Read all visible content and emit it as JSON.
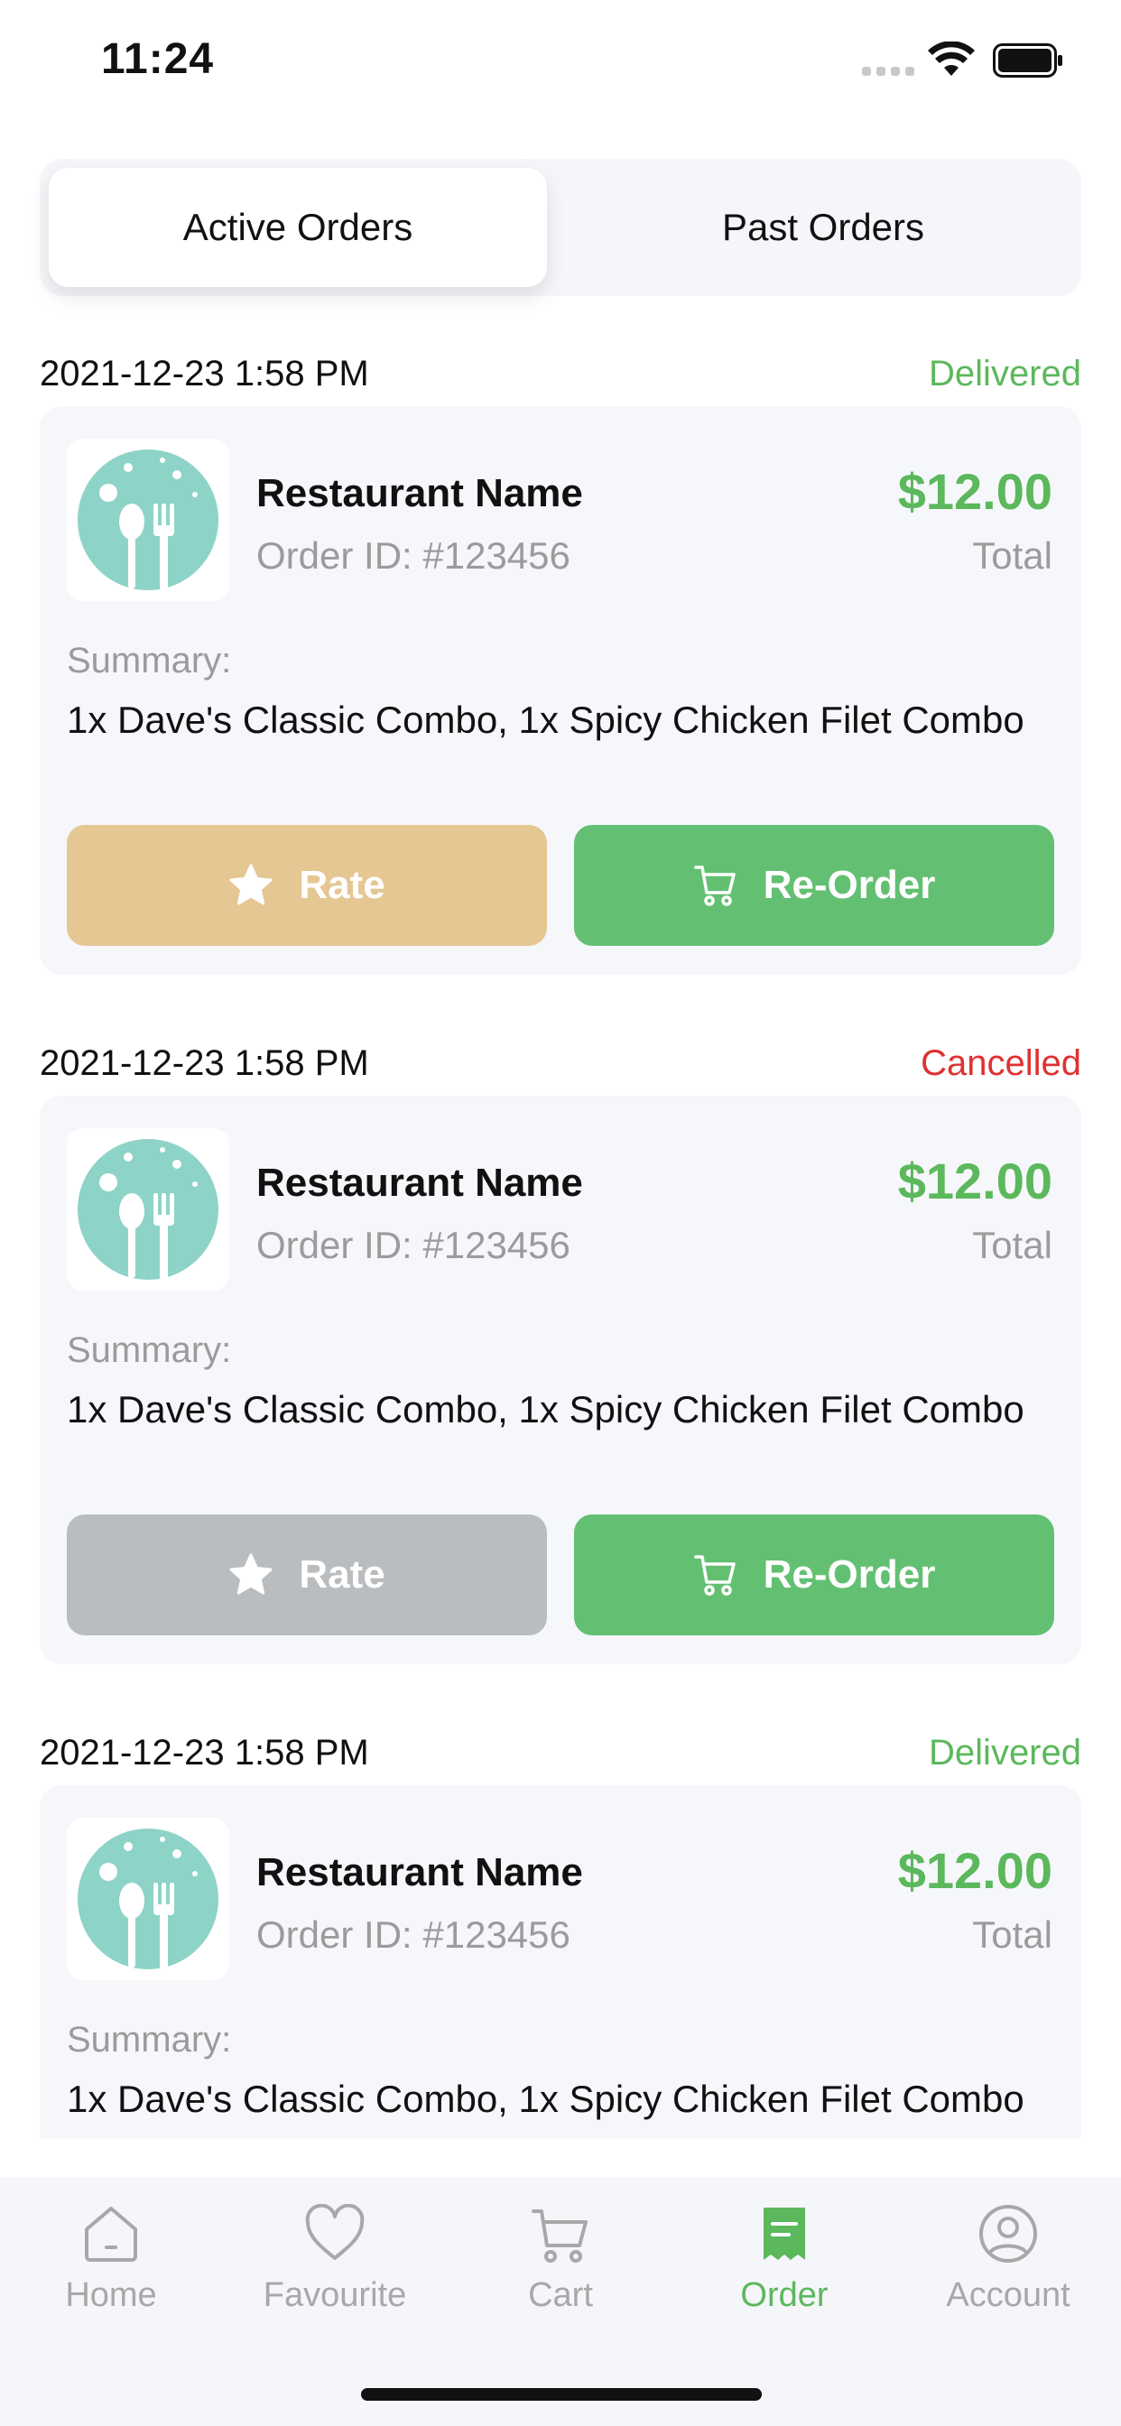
{
  "status_bar": {
    "time": "11:24"
  },
  "tabs": {
    "active": "Active Orders",
    "past": "Past Orders"
  },
  "orders": [
    {
      "date": "2021-12-23 1:58 PM",
      "status": "Delivered",
      "status_color": "#5cb85c",
      "restaurant": "Restaurant Name",
      "order_id": "Order ID: #123456",
      "price": "$12.00",
      "total_label": "Total",
      "summary_label": "Summary:",
      "summary": "1x Dave's Classic Combo, 1x Spicy Chicken Filet Combo",
      "rate_label": "Rate",
      "rate_color": "#e4c793",
      "reorder_label": "Re-Order"
    },
    {
      "date": "2021-12-23 1:58 PM",
      "status": "Cancelled",
      "status_color": "#e03131",
      "restaurant": "Restaurant Name",
      "order_id": "Order ID: #123456",
      "price": "$12.00",
      "total_label": "Total",
      "summary_label": "Summary:",
      "summary": "1x Dave's Classic Combo, 1x Spicy Chicken Filet Combo",
      "rate_label": "Rate",
      "rate_color": "#babdc0",
      "reorder_label": "Re-Order"
    },
    {
      "date": "2021-12-23 1:58 PM",
      "status": "Delivered",
      "status_color": "#5cb85c",
      "restaurant": "Restaurant Name",
      "order_id": "Order ID: #123456",
      "price": "$12.00",
      "total_label": "Total",
      "summary_label": "Summary:",
      "summary": "1x Dave's Classic Combo, 1x Spicy Chicken Filet Combo",
      "rate_label": "Rate",
      "rate_color": "#e4c793",
      "reorder_label": "Re-Order"
    }
  ],
  "nav": {
    "items": [
      {
        "label": "Home",
        "icon": "home-icon"
      },
      {
        "label": "Favourite",
        "icon": "heart-icon"
      },
      {
        "label": "Cart",
        "icon": "cart-icon"
      },
      {
        "label": "Order",
        "icon": "receipt-icon",
        "active": true
      },
      {
        "label": "Account",
        "icon": "account-icon"
      }
    ]
  },
  "colors": {
    "accent": "#5cb85c",
    "reorder": "#63c073",
    "logo": "#8ed3c7"
  }
}
